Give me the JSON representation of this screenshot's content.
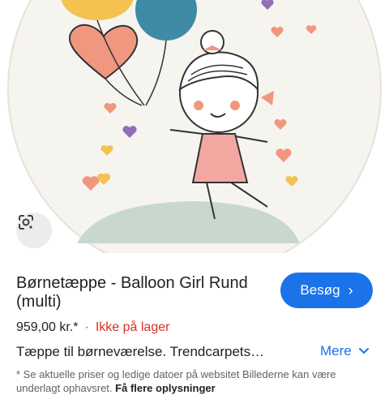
{
  "product": {
    "title": "Børnetæppe - Balloon Girl Rund (multi)",
    "price": "959,00 kr.*",
    "separator": "·",
    "availability": "Ikke på lager",
    "description": "Tæppe til børneværelse. Trendcarpets…"
  },
  "actions": {
    "visit_label": "Besøg",
    "more_label": "Mere"
  },
  "disclaimer": {
    "text": "* Se aktuelle priser og ledige datoer på websitet Billederne kan være underlagt ophavsret.",
    "link": "Få flere oplysninger"
  },
  "colors": {
    "accent": "#1a73e8",
    "out_of_stock": "#d93025"
  },
  "icons": {
    "lens": "google-lens-icon",
    "visit_chevron": "chevron-right-icon",
    "more_chevron": "chevron-down-icon"
  }
}
